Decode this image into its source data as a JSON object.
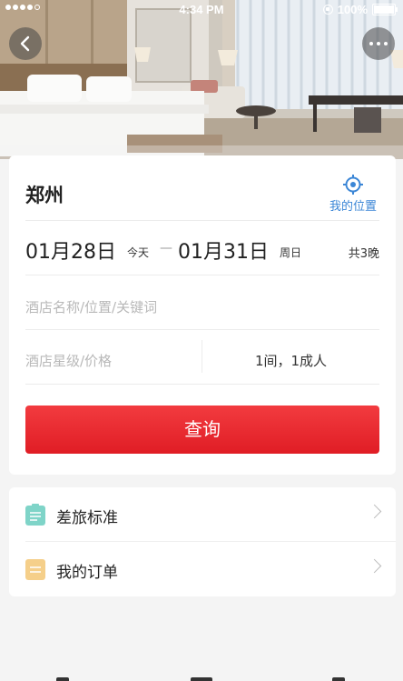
{
  "status_bar": {
    "time": "4:34 PM",
    "battery": "100%"
  },
  "hero": {
    "image": "hotel-room-photo"
  },
  "search": {
    "city": "郑州",
    "location_label": "我的位置",
    "checkin_date": "01月28日",
    "checkin_day": "今天",
    "checkout_date": "01月31日",
    "checkout_day": "周日",
    "nights": "共3晚",
    "keyword_placeholder": "酒店名称/位置/关键词",
    "star_price_placeholder": "酒店星级/价格",
    "rooms_guests": "1间，1成人",
    "button_label": "查询"
  },
  "menu": {
    "items": [
      {
        "label": "差旅标准",
        "icon": "document-icon",
        "color": "#7fd4c8"
      },
      {
        "label": "我的订单",
        "icon": "order-icon",
        "color": "#f5cf8a"
      }
    ]
  },
  "colors": {
    "accent_red": "#e8262c",
    "link_blue": "#3b86d6",
    "background": "#f4f4f4"
  }
}
